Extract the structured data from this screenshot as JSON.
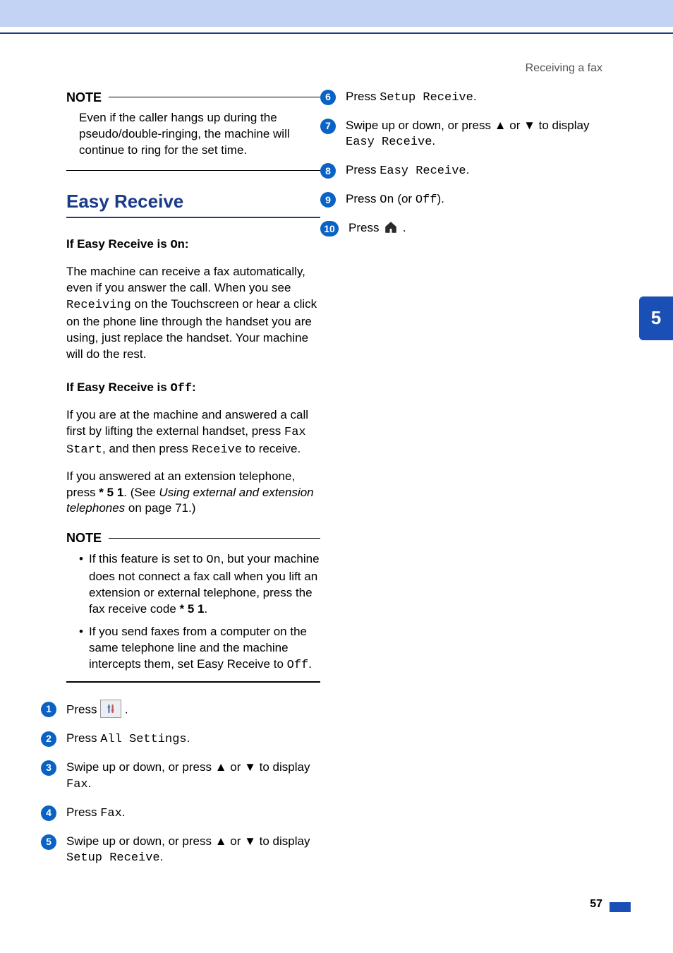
{
  "breadcrumb": "Receiving a fax",
  "chapter_tab": "5",
  "page_number": "57",
  "left": {
    "note1": {
      "label": "NOTE",
      "body": "Even if the caller hangs up during the pseudo/double-ringing, the machine will continue to ring for the set time."
    },
    "section_title": "Easy Receive",
    "sub1": {
      "prefix": "If Easy Receive is ",
      "mono": "On",
      "suffix": ":"
    },
    "para1a": "The machine can receive a fax automatically, even if you answer the call. When you see ",
    "para1b_mono": "Receiving",
    "para1c": " on the Touchscreen or hear a click on the phone line through the handset you are using, just replace the handset. Your machine will do the rest.",
    "sub2": {
      "prefix": "If Easy Receive is ",
      "mono": "Off",
      "suffix": ":"
    },
    "para2a": "If you are at the machine and answered a call first by lifting the external handset, press ",
    "para2b_mono": "Fax Start",
    "para2c": ", and then press ",
    "para2d_mono": "Receive",
    "para2e": " to receive.",
    "para3a": "If you answered at an extension telephone, press ",
    "para3b_bold": "* 5 1",
    "para3c": ". (See ",
    "para3d_italic": "Using external and extension telephones",
    "para3e": " on page 71.)",
    "note2": {
      "label": "NOTE",
      "b1a": "If this feature is set to ",
      "b1b_mono": "On",
      "b1c": ", but your machine does not connect a fax call when you lift an extension or external telephone, press the fax receive code ",
      "b1d_bold": "* 5 1",
      "b1e": ".",
      "b2a": "If you send faxes from a computer on the same telephone line and the machine intercepts them, set Easy Receive to ",
      "b2b_mono": "Off",
      "b2c": "."
    },
    "steps": {
      "s1": {
        "n": "1",
        "t1": "Press ",
        "t2": "."
      },
      "s2": {
        "n": "2",
        "t1": "Press ",
        "mono": "All Settings",
        "t2": "."
      },
      "s3": {
        "n": "3",
        "t1": "Swipe up or down, or press ▲ or ▼ to display ",
        "mono": "Fax",
        "t2": "."
      },
      "s4": {
        "n": "4",
        "t1": "Press ",
        "mono": "Fax",
        "t2": "."
      },
      "s5": {
        "n": "5",
        "t1": "Swipe up or down, or press ▲ or ▼ to display ",
        "mono": "Setup Receive",
        "t2": "."
      }
    }
  },
  "right": {
    "steps": {
      "s6": {
        "n": "6",
        "t1": "Press ",
        "mono": "Setup Receive",
        "t2": "."
      },
      "s7": {
        "n": "7",
        "t1": "Swipe up or down, or press ▲ or ▼ to display ",
        "mono": "Easy Receive",
        "t2": "."
      },
      "s8": {
        "n": "8",
        "t1": "Press ",
        "mono": "Easy Receive",
        "t2": "."
      },
      "s9": {
        "n": "9",
        "t1": "Press ",
        "mono1": "On",
        "t2": " (or ",
        "mono2": "Off",
        "t3": ")."
      },
      "s10": {
        "n": "10",
        "t1": "Press ",
        "t2": "."
      }
    }
  }
}
